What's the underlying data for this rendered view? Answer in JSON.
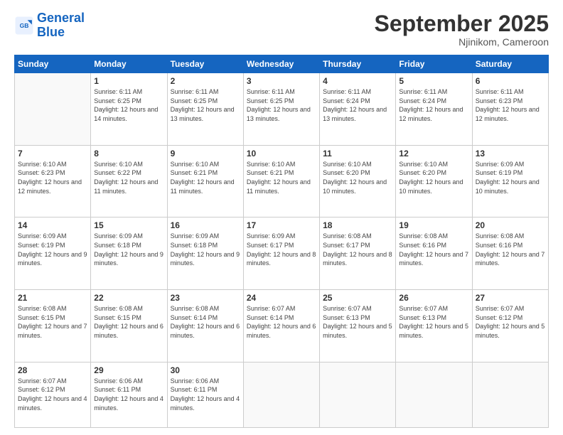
{
  "header": {
    "logo_line1": "General",
    "logo_line2": "Blue",
    "month": "September 2025",
    "location": "Njinikom, Cameroon"
  },
  "days_of_week": [
    "Sunday",
    "Monday",
    "Tuesday",
    "Wednesday",
    "Thursday",
    "Friday",
    "Saturday"
  ],
  "weeks": [
    [
      {
        "day": "",
        "info": ""
      },
      {
        "day": "1",
        "info": "Sunrise: 6:11 AM\nSunset: 6:25 PM\nDaylight: 12 hours\nand 14 minutes."
      },
      {
        "day": "2",
        "info": "Sunrise: 6:11 AM\nSunset: 6:25 PM\nDaylight: 12 hours\nand 13 minutes."
      },
      {
        "day": "3",
        "info": "Sunrise: 6:11 AM\nSunset: 6:25 PM\nDaylight: 12 hours\nand 13 minutes."
      },
      {
        "day": "4",
        "info": "Sunrise: 6:11 AM\nSunset: 6:24 PM\nDaylight: 12 hours\nand 13 minutes."
      },
      {
        "day": "5",
        "info": "Sunrise: 6:11 AM\nSunset: 6:24 PM\nDaylight: 12 hours\nand 12 minutes."
      },
      {
        "day": "6",
        "info": "Sunrise: 6:11 AM\nSunset: 6:23 PM\nDaylight: 12 hours\nand 12 minutes."
      }
    ],
    [
      {
        "day": "7",
        "info": "Sunrise: 6:10 AM\nSunset: 6:23 PM\nDaylight: 12 hours\nand 12 minutes."
      },
      {
        "day": "8",
        "info": "Sunrise: 6:10 AM\nSunset: 6:22 PM\nDaylight: 12 hours\nand 11 minutes."
      },
      {
        "day": "9",
        "info": "Sunrise: 6:10 AM\nSunset: 6:21 PM\nDaylight: 12 hours\nand 11 minutes."
      },
      {
        "day": "10",
        "info": "Sunrise: 6:10 AM\nSunset: 6:21 PM\nDaylight: 12 hours\nand 11 minutes."
      },
      {
        "day": "11",
        "info": "Sunrise: 6:10 AM\nSunset: 6:20 PM\nDaylight: 12 hours\nand 10 minutes."
      },
      {
        "day": "12",
        "info": "Sunrise: 6:10 AM\nSunset: 6:20 PM\nDaylight: 12 hours\nand 10 minutes."
      },
      {
        "day": "13",
        "info": "Sunrise: 6:09 AM\nSunset: 6:19 PM\nDaylight: 12 hours\nand 10 minutes."
      }
    ],
    [
      {
        "day": "14",
        "info": "Sunrise: 6:09 AM\nSunset: 6:19 PM\nDaylight: 12 hours\nand 9 minutes."
      },
      {
        "day": "15",
        "info": "Sunrise: 6:09 AM\nSunset: 6:18 PM\nDaylight: 12 hours\nand 9 minutes."
      },
      {
        "day": "16",
        "info": "Sunrise: 6:09 AM\nSunset: 6:18 PM\nDaylight: 12 hours\nand 9 minutes."
      },
      {
        "day": "17",
        "info": "Sunrise: 6:09 AM\nSunset: 6:17 PM\nDaylight: 12 hours\nand 8 minutes."
      },
      {
        "day": "18",
        "info": "Sunrise: 6:08 AM\nSunset: 6:17 PM\nDaylight: 12 hours\nand 8 minutes."
      },
      {
        "day": "19",
        "info": "Sunrise: 6:08 AM\nSunset: 6:16 PM\nDaylight: 12 hours\nand 7 minutes."
      },
      {
        "day": "20",
        "info": "Sunrise: 6:08 AM\nSunset: 6:16 PM\nDaylight: 12 hours\nand 7 minutes."
      }
    ],
    [
      {
        "day": "21",
        "info": "Sunrise: 6:08 AM\nSunset: 6:15 PM\nDaylight: 12 hours\nand 7 minutes."
      },
      {
        "day": "22",
        "info": "Sunrise: 6:08 AM\nSunset: 6:15 PM\nDaylight: 12 hours\nand 6 minutes."
      },
      {
        "day": "23",
        "info": "Sunrise: 6:08 AM\nSunset: 6:14 PM\nDaylight: 12 hours\nand 6 minutes."
      },
      {
        "day": "24",
        "info": "Sunrise: 6:07 AM\nSunset: 6:14 PM\nDaylight: 12 hours\nand 6 minutes."
      },
      {
        "day": "25",
        "info": "Sunrise: 6:07 AM\nSunset: 6:13 PM\nDaylight: 12 hours\nand 5 minutes."
      },
      {
        "day": "26",
        "info": "Sunrise: 6:07 AM\nSunset: 6:13 PM\nDaylight: 12 hours\nand 5 minutes."
      },
      {
        "day": "27",
        "info": "Sunrise: 6:07 AM\nSunset: 6:12 PM\nDaylight: 12 hours\nand 5 minutes."
      }
    ],
    [
      {
        "day": "28",
        "info": "Sunrise: 6:07 AM\nSunset: 6:12 PM\nDaylight: 12 hours\nand 4 minutes."
      },
      {
        "day": "29",
        "info": "Sunrise: 6:06 AM\nSunset: 6:11 PM\nDaylight: 12 hours\nand 4 minutes."
      },
      {
        "day": "30",
        "info": "Sunrise: 6:06 AM\nSunset: 6:11 PM\nDaylight: 12 hours\nand 4 minutes."
      },
      {
        "day": "",
        "info": ""
      },
      {
        "day": "",
        "info": ""
      },
      {
        "day": "",
        "info": ""
      },
      {
        "day": "",
        "info": ""
      }
    ]
  ]
}
